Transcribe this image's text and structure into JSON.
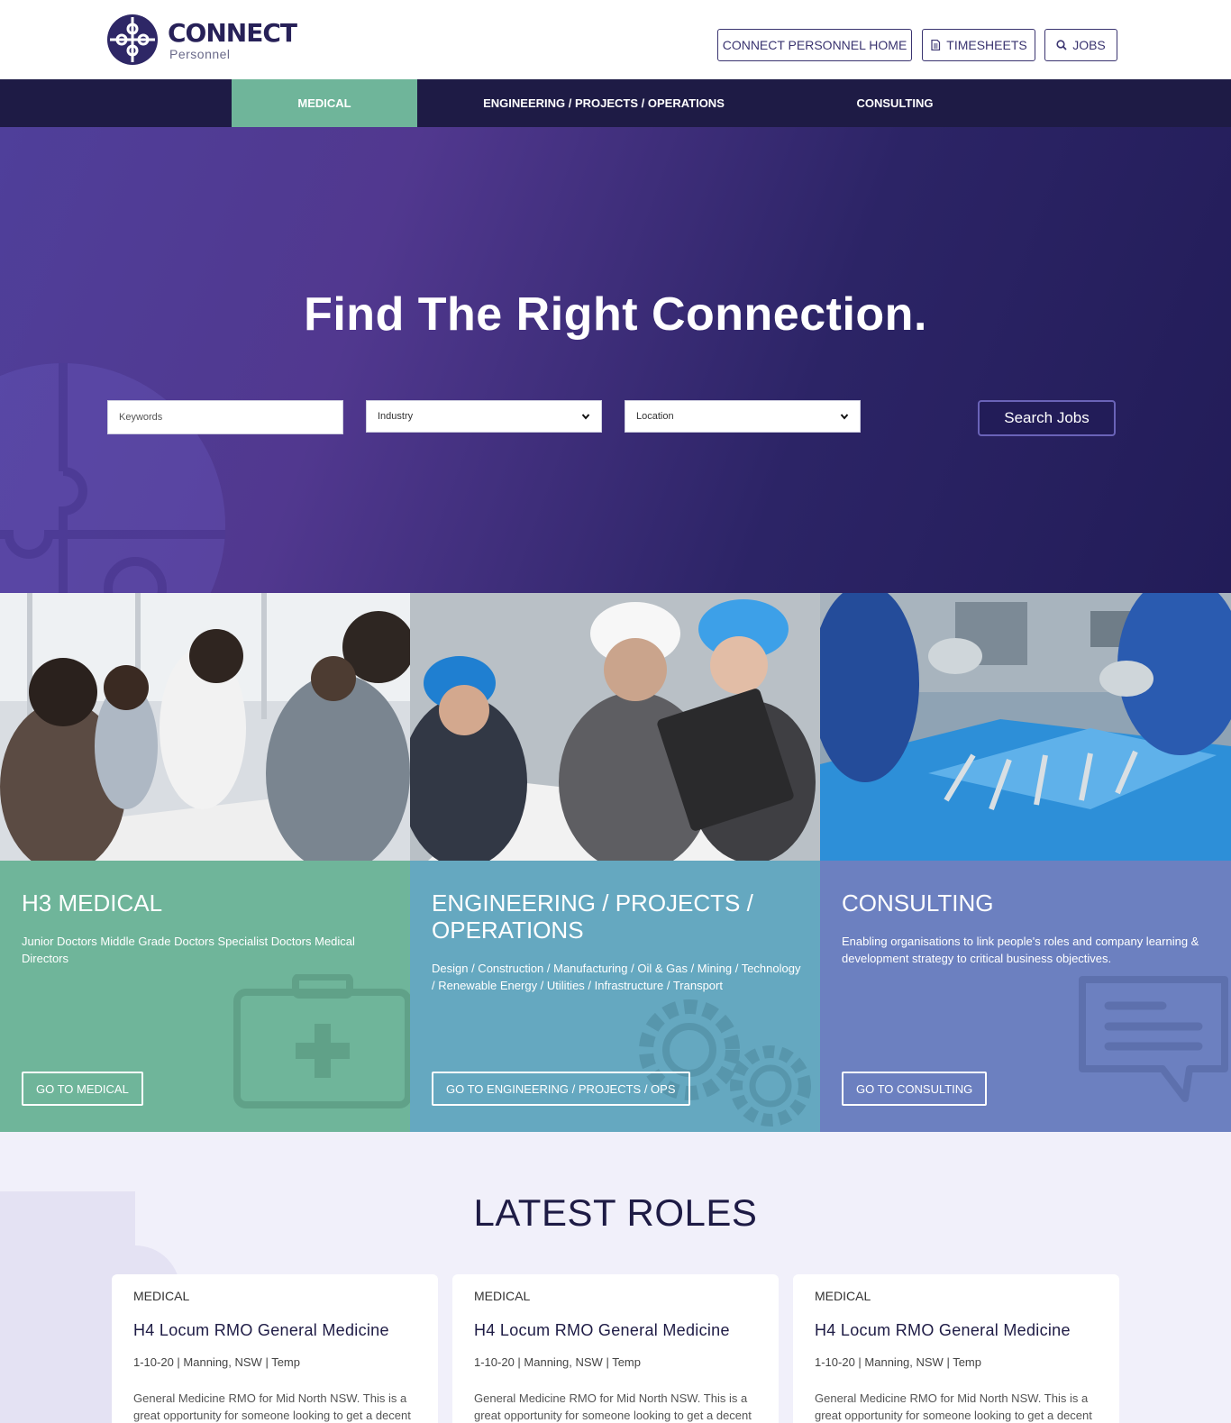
{
  "brand": {
    "name": "CONNECT",
    "sub": "Personnel"
  },
  "top_buttons": {
    "home": "CONNECT PERSONNEL HOME",
    "timesheets": "TIMESHEETS",
    "jobs": "JOBS"
  },
  "nav": {
    "items": [
      {
        "label": "MEDICAL"
      },
      {
        "label": "ENGINEERING / PROJECTS / OPERATIONS"
      },
      {
        "label": "CONSULTING"
      }
    ]
  },
  "hero": {
    "title": "Find The Right Connection.",
    "keywords_placeholder": "Keywords",
    "industry_selected": "Industry",
    "location_selected": "Location",
    "search_label": "Search Jobs"
  },
  "sectors": [
    {
      "title": "H3 MEDICAL",
      "desc": "Junior Doctors Middle Grade Doctors Specialist Doctors Medical Directors",
      "button": "GO TO MEDICAL",
      "color": "#6fb59a"
    },
    {
      "title": "ENGINEERING / PROJECTS / OPERATIONS",
      "desc": "Design / Construction / Manufacturing / Oil & Gas / Mining / Technology / Renewable Energy / Utilities / Infrastructure / Transport",
      "button": "GO TO ENGINEERING / PROJECTS / OPS",
      "color": "#65a8c0"
    },
    {
      "title": "CONSULTING",
      "desc": "Enabling organisations to link people's roles and company learning & development strategy to critical business objectives.",
      "button": "GO TO CONSULTING",
      "color": "#6c80c0"
    }
  ],
  "latest": {
    "title": "LATEST ROLES",
    "cards": [
      {
        "category": "MEDICAL",
        "title": "H4 Locum RMO General Medicine",
        "meta": "1-10-20 | Manning, NSW | Temp",
        "desc": "General Medicine RMO for Mid North NSW. This is a great opportunity for someone looking to get a decent"
      },
      {
        "category": "MEDICAL",
        "title": "H4 Locum RMO General Medicine",
        "meta": "1-10-20 | Manning, NSW | Temp",
        "desc": "General Medicine RMO for Mid North NSW. This is a great opportunity for someone looking to get a decent"
      },
      {
        "category": "MEDICAL",
        "title": "H4 Locum RMO General Medicine",
        "meta": "1-10-20 | Manning, NSW | Temp",
        "desc": "General Medicine RMO for Mid North NSW. This is a great opportunity for someone looking to get a decent"
      }
    ]
  },
  "colors": {
    "navy": "#1e1b45",
    "medical_green": "#6fb59a",
    "engineering_blue": "#65a8c0",
    "consulting_blue": "#6c80c0",
    "hero_purple": "#4f3f9a"
  }
}
